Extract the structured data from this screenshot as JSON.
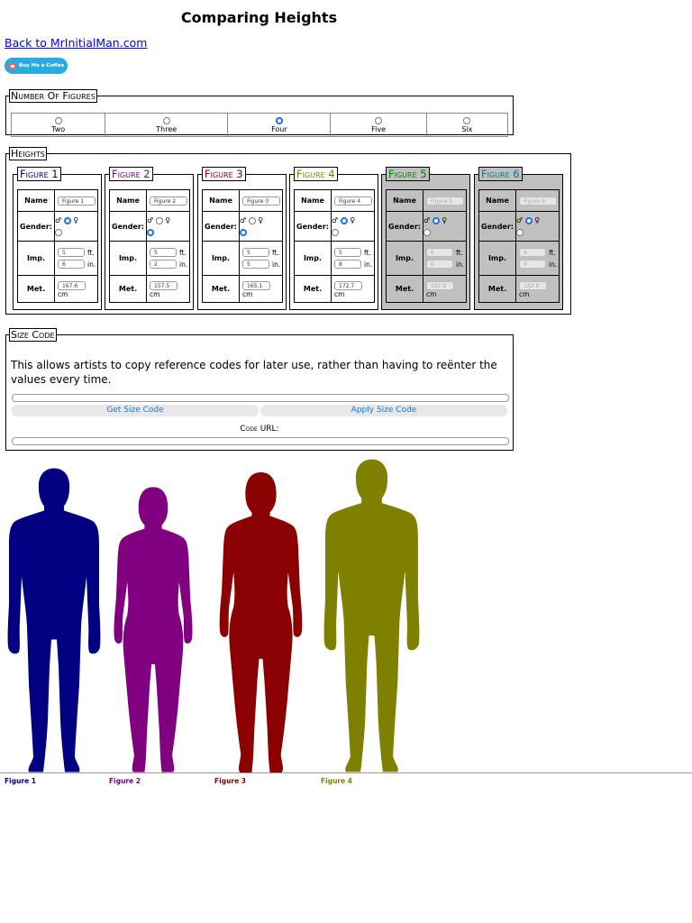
{
  "page": {
    "title": "Comparing Heights",
    "back_link": "Back to MrInitialMan.com",
    "coffee_label": "Buy Me a Coffee"
  },
  "number_of_figures": {
    "legend": "Number Of Figures",
    "options": [
      "Two",
      "Three",
      "Four",
      "Five",
      "Six"
    ],
    "selected": "Four"
  },
  "heights": {
    "legend": "Heights",
    "row_labels": {
      "name": "Name",
      "gender": "Gender:",
      "imp": "Imp.",
      "met": "Met.",
      "ft": "ft.",
      "in": "in.",
      "cm": "cm"
    },
    "gender_symbols": {
      "male": "♂",
      "female": "♀"
    },
    "figures": [
      {
        "legend": "Figure 1",
        "color": "#000080",
        "name": "Figure 1",
        "gender": "male",
        "ft": "5",
        "in": "6",
        "cm": "167.6",
        "disabled": false
      },
      {
        "legend": "Figure 2",
        "color": "#800080",
        "name": "Figure 2",
        "gender": "female",
        "ft": "5",
        "in": "2",
        "cm": "157.5",
        "disabled": false
      },
      {
        "legend": "Figure 3",
        "color": "#8b0000",
        "name": "Figure 3",
        "gender": "female",
        "ft": "5",
        "in": "5",
        "cm": "165.1",
        "disabled": false
      },
      {
        "legend": "Figure 4",
        "color": "#808000",
        "name": "Figure 4",
        "gender": "male",
        "ft": "5",
        "in": "8",
        "cm": "172.7",
        "disabled": false
      },
      {
        "legend": "Figure 5",
        "color": "#008000",
        "name": "Figure 5",
        "gender": "male",
        "ft": "6",
        "in": "0",
        "cm": "182.9",
        "disabled": true
      },
      {
        "legend": "Figure 6",
        "color": "#008080",
        "name": "Figure 6",
        "gender": "male",
        "ft": "6",
        "in": "0",
        "cm": "182.9",
        "disabled": true
      }
    ]
  },
  "size_code": {
    "legend": "Size Code",
    "description": "This allows artists to copy reference codes for later use, rather than having to reënter the values every time.",
    "get_button": "Get Size Code",
    "apply_button": "Apply Size Code",
    "code_url_word": "Code",
    "code_url_rest": " URL:"
  },
  "silhouettes": [
    {
      "label": "Figure 1",
      "color": "#000080",
      "gender": "male"
    },
    {
      "label": "Figure 2",
      "color": "#800080",
      "gender": "female"
    },
    {
      "label": "Figure 3",
      "color": "#8b0000",
      "gender": "female"
    },
    {
      "label": "Figure 4",
      "color": "#808000",
      "gender": "male"
    }
  ]
}
